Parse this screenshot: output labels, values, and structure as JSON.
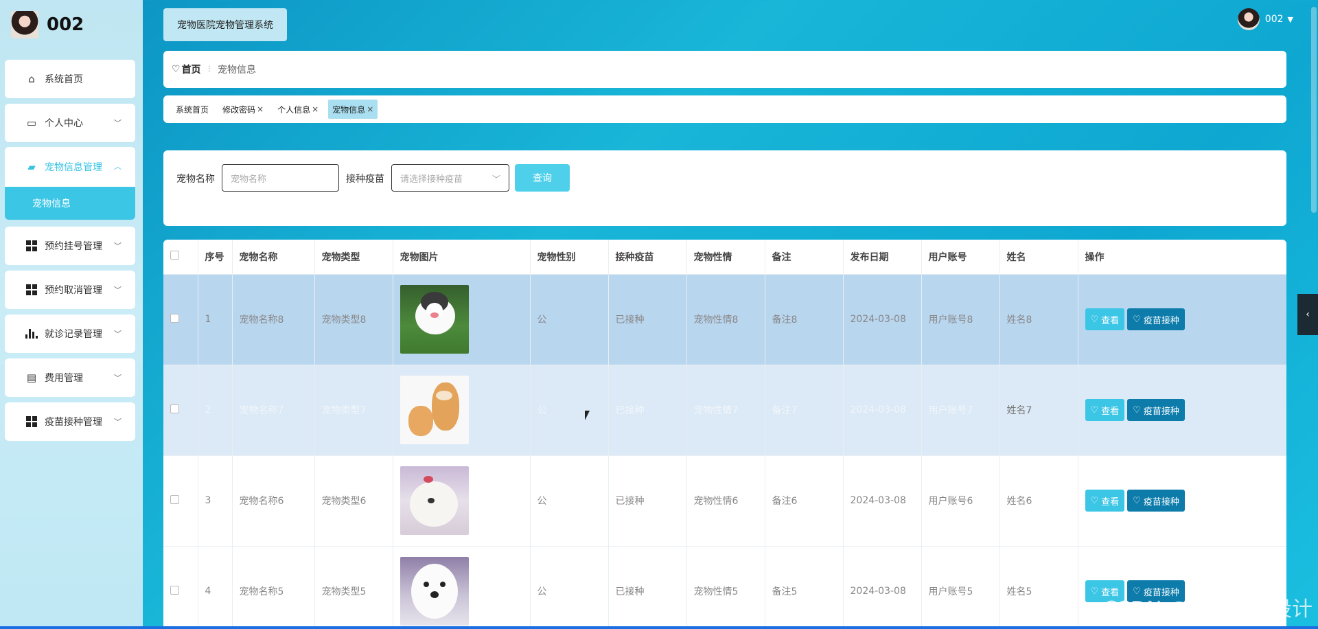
{
  "sidebar": {
    "username": "002",
    "items": [
      {
        "label": "系统首页",
        "icon": "home-icon"
      },
      {
        "label": "个人中心",
        "icon": "card-icon"
      },
      {
        "label": "宠物信息管理",
        "icon": "chart-icon"
      },
      {
        "label": "预约挂号管理",
        "icon": "grid-icon"
      },
      {
        "label": "预约取消管理",
        "icon": "grid-icon"
      },
      {
        "label": "就诊记录管理",
        "icon": "bar-chart-icon"
      },
      {
        "label": "费用管理",
        "icon": "clipboard-icon"
      },
      {
        "label": "疫苗接种管理",
        "icon": "grid-icon"
      }
    ],
    "submenu_active": "宠物信息"
  },
  "header": {
    "system_title": "宠物医院宠物管理系统",
    "user": "002"
  },
  "breadcrumb": {
    "home": "首页",
    "current": "宠物信息"
  },
  "tabs": [
    {
      "label": "系统首页",
      "closable": false
    },
    {
      "label": "修改密码",
      "closable": true
    },
    {
      "label": "个人信息",
      "closable": true
    },
    {
      "label": "宠物信息",
      "closable": true,
      "active": true
    }
  ],
  "search": {
    "name_label": "宠物名称",
    "name_placeholder": "宠物名称",
    "vaccine_label": "接种疫苗",
    "vaccine_placeholder": "请选择接种疫苗",
    "query_button": "查询"
  },
  "table": {
    "headers": [
      "序号",
      "宠物名称",
      "宠物类型",
      "宠物图片",
      "宠物性别",
      "接种疫苗",
      "宠物性情",
      "备注",
      "发布日期",
      "用户账号",
      "姓名",
      "操作"
    ],
    "rows": [
      {
        "no": "1",
        "name": "宠物名称8",
        "type": "宠物类型8",
        "gender": "公",
        "vaccine": "已接种",
        "temper": "宠物性情8",
        "note": "备注8",
        "date": "2024-03-08",
        "account": "用户账号8",
        "person": "姓名8"
      },
      {
        "no": "2",
        "name": "宠物名称7",
        "type": "宠物类型7",
        "gender": "公",
        "vaccine": "已接种",
        "temper": "宠物性情7",
        "note": "备注7",
        "date": "2024-03-08",
        "account": "用户账号7",
        "person": "姓名7"
      },
      {
        "no": "3",
        "name": "宠物名称6",
        "type": "宠物类型6",
        "gender": "公",
        "vaccine": "已接种",
        "temper": "宠物性情6",
        "note": "备注6",
        "date": "2024-03-08",
        "account": "用户账号6",
        "person": "姓名6"
      },
      {
        "no": "4",
        "name": "宠物名称5",
        "type": "宠物类型5",
        "gender": "公",
        "vaccine": "已接种",
        "temper": "宠物性情5",
        "note": "备注5",
        "date": "2024-03-08",
        "account": "用户账号5",
        "person": "姓名5"
      }
    ],
    "actions": {
      "view": "查看",
      "vaccinate": "疫苗接种"
    }
  },
  "watermark": "CSDN @便捷程序设计",
  "colors": {
    "accent": "#3cc6e6",
    "dark_button": "#0d7cab",
    "selected_row": "#b9d6ef"
  }
}
